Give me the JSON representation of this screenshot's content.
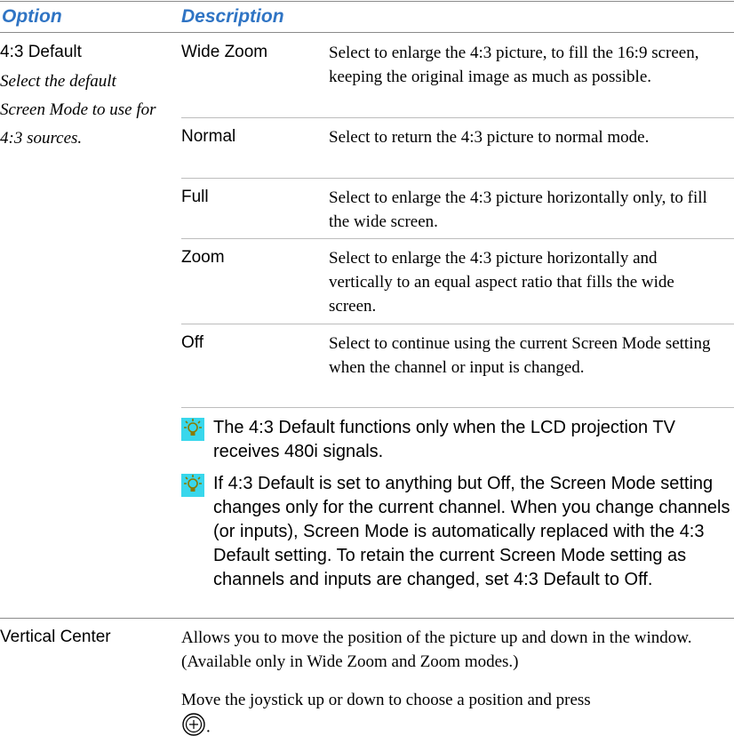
{
  "header": {
    "option": "Option",
    "description": "Description"
  },
  "default43": {
    "title": "4:3 Default",
    "description": "Select the default Screen Mode to use for 4:3 sources.",
    "modes": [
      {
        "label": "Wide Zoom",
        "text": "Select to enlarge the 4:3 picture, to fill the 16:9 screen, keeping the original image as much as possible."
      },
      {
        "label": "Normal",
        "text": "Select to return the 4:3 picture to normal mode."
      },
      {
        "label": "Full",
        "text": "Select to enlarge the 4:3 picture horizontally only, to fill the wide screen."
      },
      {
        "label": "Zoom",
        "text": "Select to enlarge the 4:3 picture horizontally and vertically to an equal aspect ratio that fills the wide screen."
      },
      {
        "label": "Off",
        "text": "Select to continue using the current Screen Mode setting when the channel or input is changed."
      }
    ],
    "tips": [
      "The 4:3 Default functions only when the LCD projection TV receives 480i signals.",
      "If 4:3 Default is set to anything but Off, the Screen Mode setting changes only for the current channel. When you change channels (or inputs), Screen Mode is automatically replaced with the 4:3 Default setting. To retain the current Screen Mode setting as channels and inputs are changed, set 4:3 Default to Off."
    ]
  },
  "vertical_center": {
    "title": "Vertical Center",
    "description": "Allows you to move the position of the picture up and down in the window. (Available only in Wide Zoom and Zoom modes.)",
    "instruction": "Move the joystick up or down to choose a position and press",
    "instruction_end": "."
  },
  "colors": {
    "header": "#2f74c4",
    "tip_icon": "#39d7ec",
    "rule": "#8a8a8a"
  },
  "icons": {
    "tip": "lightbulb-icon",
    "joystick": "joystick-button-icon"
  }
}
